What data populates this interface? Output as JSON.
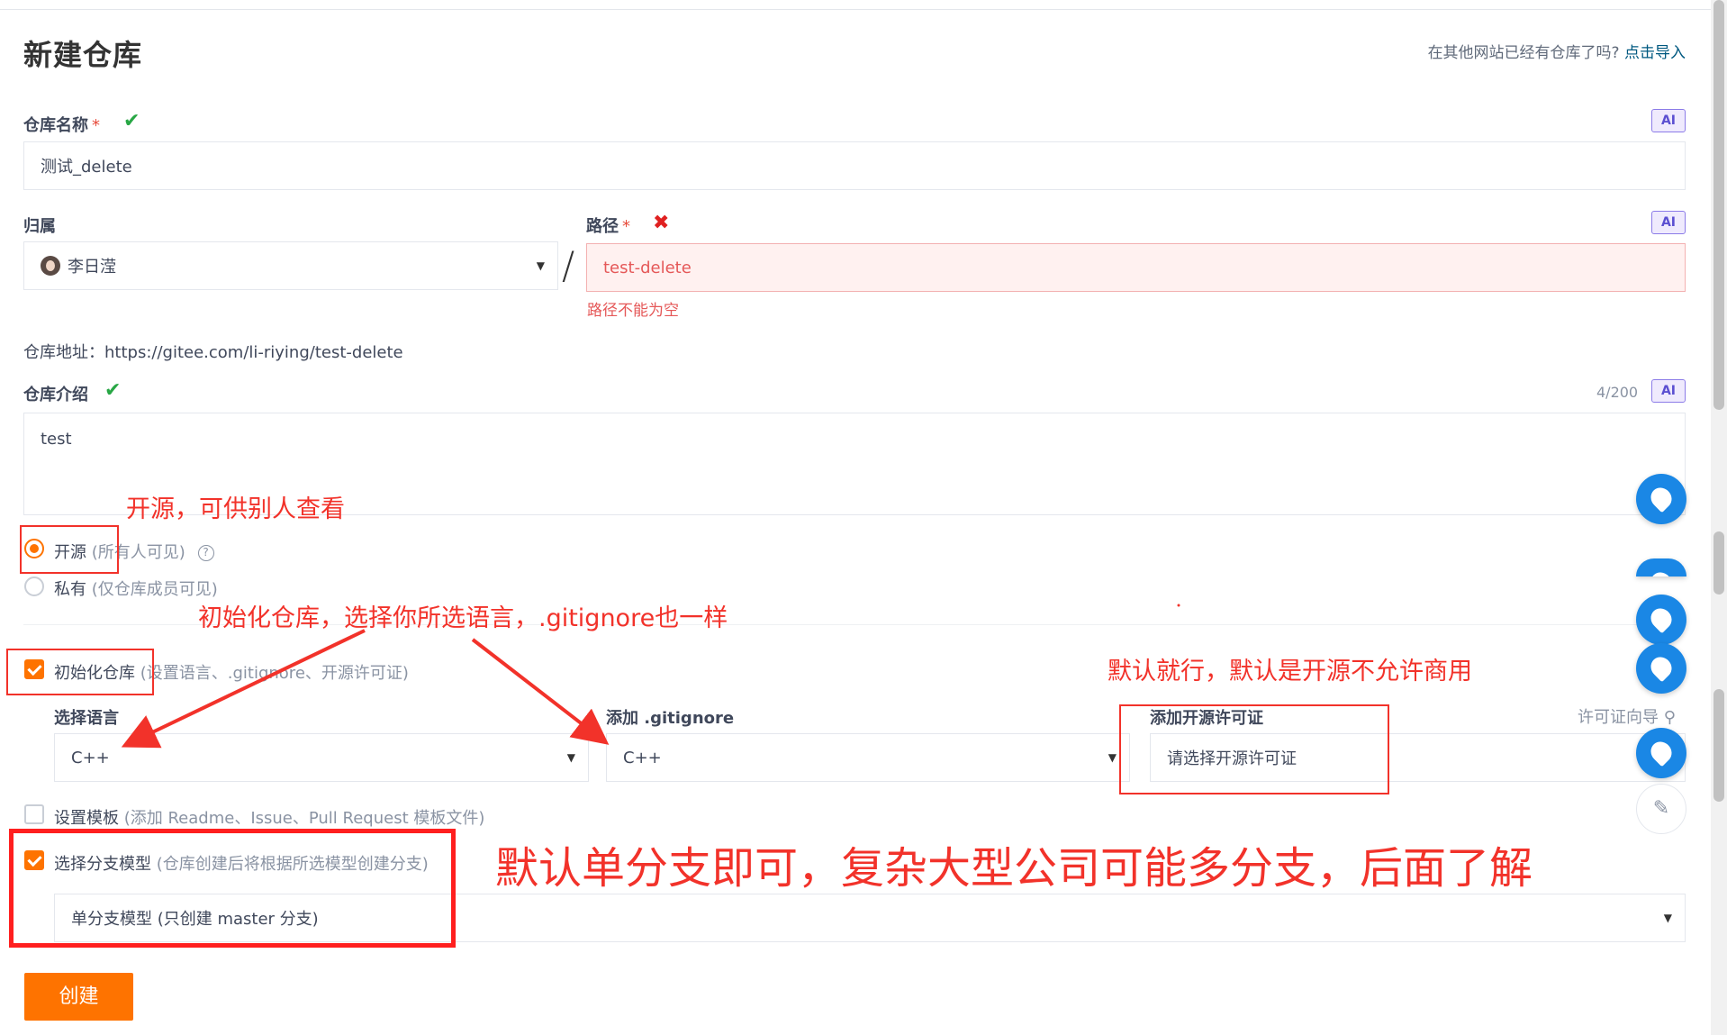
{
  "page": {
    "title": "新建仓库",
    "import_prefix": "在其他网站已经有仓库了吗?",
    "import_link": "点击导入"
  },
  "repo_name": {
    "label": "仓库名称",
    "required": "*",
    "ok_icon": "✔",
    "ai": "AI",
    "value": "测试_delete"
  },
  "owner": {
    "label": "归属",
    "value": "李日滢"
  },
  "path": {
    "label": "路径",
    "required": "*",
    "err_icon": "✖",
    "ai": "AI",
    "value": "test-delete",
    "error": "路径不能为空"
  },
  "separator": "/",
  "repo_url": "仓库地址：https://gitee.com/li-riying/test-delete",
  "description": {
    "label": "仓库介绍",
    "ok_icon": "✔",
    "counter": "4/200",
    "ai": "AI",
    "value": "test"
  },
  "visibility": {
    "public_label": "开源",
    "public_hint": "(所有人可见)",
    "help": "?",
    "private_label": "私有",
    "private_hint": "(仅仓库成员可见)"
  },
  "init": {
    "label": "初始化仓库",
    "hint": "(设置语言、.gitignore、开源许可证)",
    "checked": true,
    "language_label": "选择语言",
    "language_value": "C++",
    "gitignore_label": "添加 .gitignore",
    "gitignore_value": "C++",
    "license_label": "添加开源许可证",
    "license_value": "请选择开源许可证",
    "license_wizard": "许可证向导"
  },
  "template": {
    "label": "设置模板",
    "hint": "(添加 Readme、Issue、Pull Request 模板文件)",
    "checked": false
  },
  "branch": {
    "label": "选择分支模型",
    "hint": "(仓库创建后将根据所选模型创建分支)",
    "checked": true,
    "value": "单分支模型 (只创建 master 分支)"
  },
  "create_button": "创建",
  "annotations": {
    "open_source": "开源，可供别人查看",
    "init_repo": "初始化仓库，选择你所选语言，.gitignore也一样",
    "license": "默认就行，默认是开源不允许商用",
    "branch": "默认单分支即可，复杂大型公司可能多分支，后面了解"
  },
  "colors": {
    "accent": "#fe7300",
    "annotation": "#f2322a",
    "link": "#005980",
    "success": "#28a745",
    "error": "#e02020"
  }
}
